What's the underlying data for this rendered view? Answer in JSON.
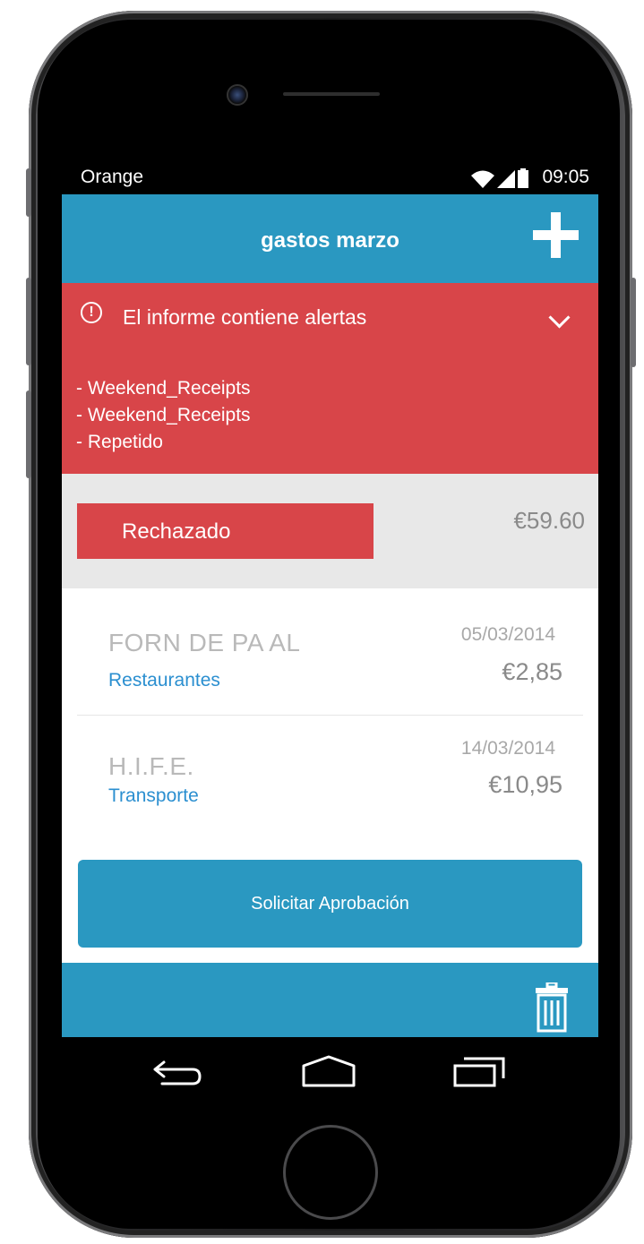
{
  "status_bar": {
    "carrier": "Orange",
    "time": "09:05",
    "icons": [
      "wifi-icon",
      "signal-icon",
      "battery-icon"
    ]
  },
  "header": {
    "title": "gastos marzo",
    "add_icon": "plus-icon"
  },
  "alert": {
    "title": "El informe contiene alertas",
    "icon": "exclamation-circle-icon",
    "items": [
      "- Weekend_Receipts",
      "- Weekend_Receipts",
      "- Repetido"
    ]
  },
  "report": {
    "status": "Rechazado",
    "total": "€59.60"
  },
  "expenses": [
    {
      "merchant": "FORN DE PA AL",
      "category": "Restaurantes",
      "date": "05/03/2014",
      "amount": "€2,85"
    },
    {
      "merchant": "H.I.F.E.",
      "category": "Transporte",
      "date": "14/03/2014",
      "amount": "€10,95"
    }
  ],
  "actions": {
    "request_approval": "Solicitar Aprobación"
  },
  "colors": {
    "primary": "#2a98c1",
    "alert": "#d84549",
    "category_link": "#2b8fd0"
  }
}
